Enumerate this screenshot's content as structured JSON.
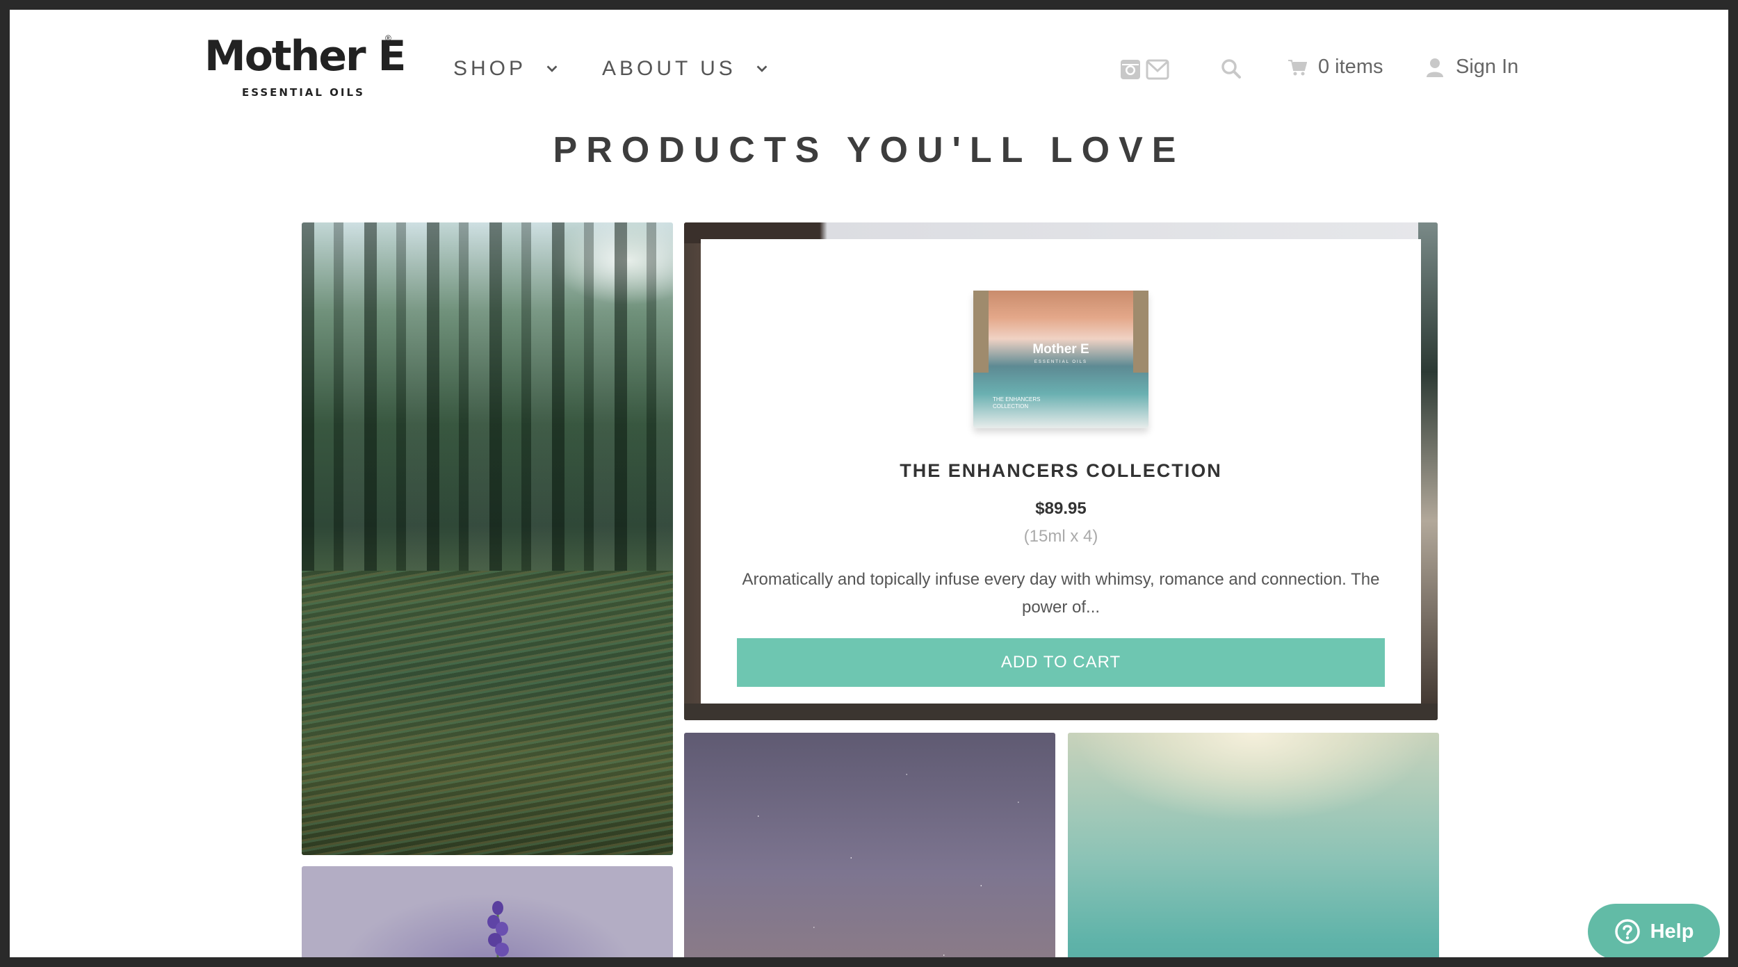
{
  "brand": {
    "name": "Mother E",
    "registered": "®",
    "tagline": "ESSENTIAL OILS"
  },
  "nav": {
    "shop_label": "SHOP",
    "about_label": "ABOUT US"
  },
  "header": {
    "cart_label": "0 items",
    "signin_label": "Sign In"
  },
  "section": {
    "title": "PRODUCTS YOU'LL LOVE"
  },
  "featured_product": {
    "image_brand": "Mother E",
    "image_brand_sub": "ESSENTIAL OILS",
    "image_label": "THE ENHANCERS COLLECTION",
    "name": "THE ENHANCERS COLLECTION",
    "price": "$89.95",
    "size": "(15ml x 4)",
    "description": "Aromatically and topically infuse every day with whimsy, romance and connection. The power of...",
    "add_to_cart_label": "ADD TO CART"
  },
  "help": {
    "label": "Help"
  },
  "colors": {
    "accent": "#6ec6b1",
    "help": "#62bba6",
    "text_dark": "#333333",
    "text_muted": "#aaaaaa"
  },
  "icons": [
    "chevron-down-icon",
    "instagram-icon",
    "mail-icon",
    "search-icon",
    "cart-icon",
    "user-icon",
    "help-circle-icon"
  ]
}
